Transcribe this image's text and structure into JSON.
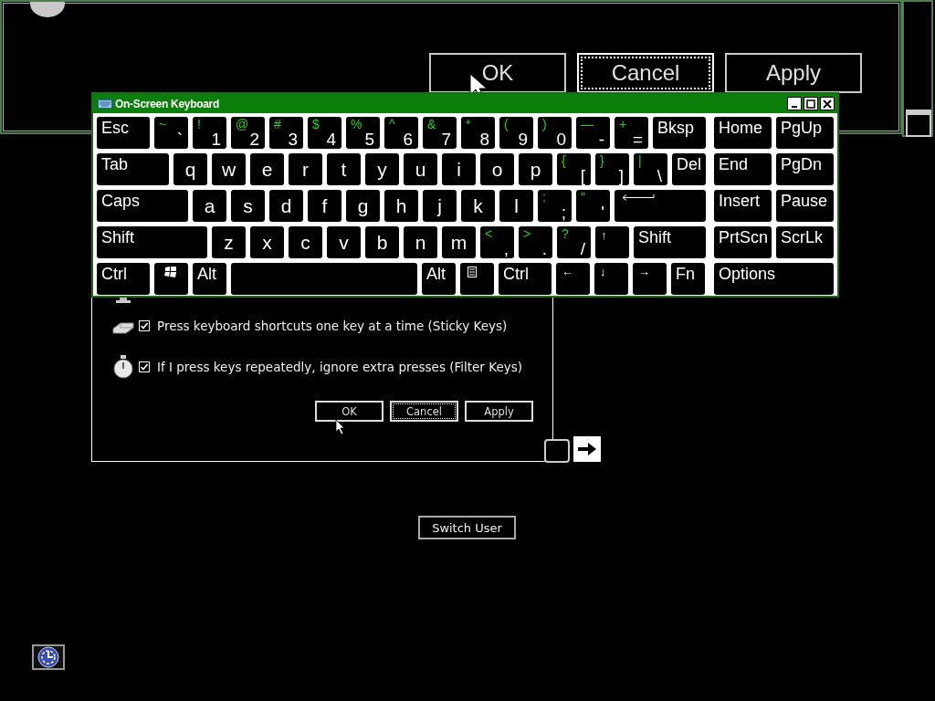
{
  "background_window": {
    "buttons": [
      {
        "label": "OK",
        "focused": false
      },
      {
        "label": "Cancel",
        "focused": true
      },
      {
        "label": "Apply",
        "focused": false
      }
    ]
  },
  "dialog": {
    "options": [
      {
        "kind": "sticky",
        "label": "Press keyboard shortcuts one key at a time (Sticky Keys)",
        "checked": true
      },
      {
        "kind": "filter",
        "label": "If I press keys repeatedly, ignore extra presses (Filter Keys)",
        "checked": true
      }
    ],
    "buttons": [
      {
        "label": "OK",
        "focused": false
      },
      {
        "label": "Cancel",
        "focused": true
      },
      {
        "label": "Apply",
        "focused": false
      }
    ]
  },
  "switch_user": {
    "label": "Switch User"
  },
  "keyboard": {
    "title": "On-Screen Keyboard",
    "main_rows": [
      [
        {
          "kind": "named",
          "label": "Esc"
        },
        {
          "kind": "char",
          "shift": "~",
          "label": "`"
        },
        {
          "kind": "char",
          "shift": "!",
          "label": "1"
        },
        {
          "kind": "char",
          "shift": "@",
          "label": "2"
        },
        {
          "kind": "char",
          "shift": "#",
          "label": "3"
        },
        {
          "kind": "char",
          "shift": "$",
          "label": "4"
        },
        {
          "kind": "char",
          "shift": "%",
          "label": "5"
        },
        {
          "kind": "char",
          "shift": "^",
          "label": "6"
        },
        {
          "kind": "char",
          "shift": "&",
          "label": "7"
        },
        {
          "kind": "char",
          "shift": "*",
          "label": "8"
        },
        {
          "kind": "char",
          "shift": "(",
          "label": "9"
        },
        {
          "kind": "char",
          "shift": ")",
          "label": "0"
        },
        {
          "kind": "char",
          "shift": "—",
          "label": "-"
        },
        {
          "kind": "char",
          "shift": "+",
          "label": "="
        },
        {
          "kind": "named",
          "label": "Bksp"
        }
      ],
      [
        {
          "kind": "named",
          "label": "Tab"
        },
        {
          "kind": "letter",
          "label": "q"
        },
        {
          "kind": "letter",
          "label": "w"
        },
        {
          "kind": "letter",
          "label": "e"
        },
        {
          "kind": "letter",
          "label": "r"
        },
        {
          "kind": "letter",
          "label": "t"
        },
        {
          "kind": "letter",
          "label": "y"
        },
        {
          "kind": "letter",
          "label": "u"
        },
        {
          "kind": "letter",
          "label": "i"
        },
        {
          "kind": "letter",
          "label": "o"
        },
        {
          "kind": "letter",
          "label": "p"
        },
        {
          "kind": "char",
          "shift": "{",
          "label": "["
        },
        {
          "kind": "char",
          "shift": "}",
          "label": "]"
        },
        {
          "kind": "char",
          "shift": "|",
          "label": "\\"
        },
        {
          "kind": "named",
          "label": "Del"
        }
      ],
      [
        {
          "kind": "named",
          "label": "Caps"
        },
        {
          "kind": "letter",
          "label": "a"
        },
        {
          "kind": "letter",
          "label": "s"
        },
        {
          "kind": "letter",
          "label": "d"
        },
        {
          "kind": "letter",
          "label": "f"
        },
        {
          "kind": "letter",
          "label": "g"
        },
        {
          "kind": "letter",
          "label": "h"
        },
        {
          "kind": "letter",
          "label": "j"
        },
        {
          "kind": "letter",
          "label": "k"
        },
        {
          "kind": "letter",
          "label": "l"
        },
        {
          "kind": "char",
          "shift": ":",
          "label": ";"
        },
        {
          "kind": "char",
          "shift": "\"",
          "label": "'"
        },
        {
          "kind": "enter"
        }
      ],
      [
        {
          "kind": "named",
          "label": "Shift"
        },
        {
          "kind": "letter",
          "label": "z"
        },
        {
          "kind": "letter",
          "label": "x"
        },
        {
          "kind": "letter",
          "label": "c"
        },
        {
          "kind": "letter",
          "label": "v"
        },
        {
          "kind": "letter",
          "label": "b"
        },
        {
          "kind": "letter",
          "label": "n"
        },
        {
          "kind": "letter",
          "label": "m"
        },
        {
          "kind": "char",
          "shift": "<",
          "label": ","
        },
        {
          "kind": "char",
          "shift": ">",
          "label": "."
        },
        {
          "kind": "char",
          "shift": "?",
          "label": "/"
        },
        {
          "kind": "arrow",
          "label": "↑"
        },
        {
          "kind": "named",
          "label": "Shift"
        }
      ],
      [
        {
          "kind": "named",
          "label": "Ctrl"
        },
        {
          "kind": "windows"
        },
        {
          "kind": "named",
          "label": "Alt"
        },
        {
          "kind": "space"
        },
        {
          "kind": "named",
          "label": "Alt"
        },
        {
          "kind": "menu"
        },
        {
          "kind": "named",
          "label": "Ctrl"
        },
        {
          "kind": "arrow",
          "label": "←"
        },
        {
          "kind": "arrow",
          "label": "↓"
        },
        {
          "kind": "arrow",
          "label": "→"
        },
        {
          "kind": "named",
          "label": "Fn"
        }
      ]
    ],
    "nav_rows": [
      [
        {
          "label": "Home"
        },
        {
          "label": "PgUp"
        }
      ],
      [
        {
          "label": "End"
        },
        {
          "label": "PgDn"
        }
      ],
      [
        {
          "label": "Insert"
        },
        {
          "label": "Pause"
        }
      ],
      [
        {
          "label": "PrtScn"
        },
        {
          "label": "ScrLk"
        }
      ],
      [
        {
          "label": "Options"
        }
      ]
    ]
  }
}
